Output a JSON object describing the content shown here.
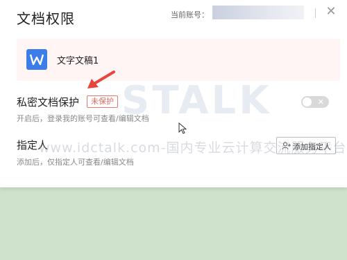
{
  "dialog": {
    "title": "文档权限",
    "account_label": "当前账号：",
    "close_glyph": "✕"
  },
  "document": {
    "icon_letter": "W",
    "name": "文字文稿1",
    "icon_color": "#3d7de8"
  },
  "private_protection": {
    "title": "私密文档保护",
    "badge": "未保护",
    "description": "开启后，登录我的账号可查看/编辑文档",
    "toggle_on": false
  },
  "designated": {
    "title": "指定人",
    "description": "添加后，仅指定人可查看/编辑文档",
    "add_button": "添加指定人"
  },
  "watermark": {
    "logo": "STALK",
    "line": "www.idctalk.com-国内专业云计算交流服务平台"
  }
}
